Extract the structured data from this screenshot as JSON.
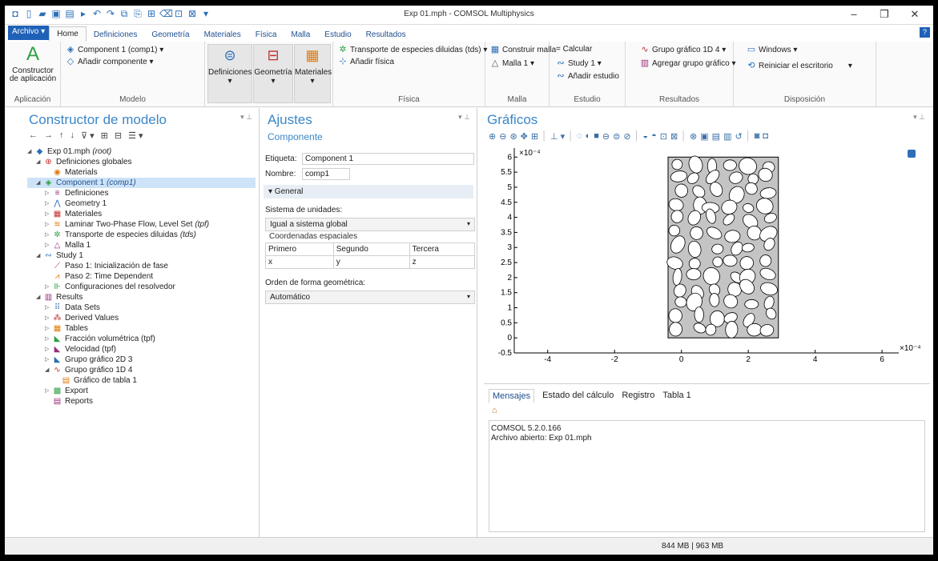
{
  "window": {
    "title": "Exp 01.mph - COMSOL Multiphysics",
    "minimize": "–",
    "restore": "❐",
    "close": "✕"
  },
  "tabs": {
    "file": "Archivo ▾",
    "items": [
      "Home",
      "Definiciones",
      "Geometría",
      "Materiales",
      "Física",
      "Malla",
      "Estudio",
      "Resultados"
    ],
    "help": "?"
  },
  "ribbon": {
    "aplicacion": {
      "btn": "Constructor de aplicación",
      "label": "Aplicación"
    },
    "modelo": {
      "component": "Component 1 (comp1) ▾",
      "add": "Añadir componente ▾",
      "label": "Modelo"
    },
    "defs": {
      "definiciones": "Definiciones",
      "geometria": "Geometría",
      "materiales": "Materiales",
      "arrow": "▾"
    },
    "fisica": {
      "transporte": "Transporte de especies diluidas (tds) ▾",
      "add": "Añadir física",
      "label": "Física"
    },
    "malla": {
      "construir": "Construir malla",
      "malla1": "Malla 1 ▾",
      "label": "Malla"
    },
    "estudio": {
      "calcular": "= Calcular",
      "study": "Study 1 ▾",
      "add": "Añadir estudio",
      "label": "Estudio"
    },
    "resultados": {
      "grupo1d": "Grupo gráfico 1D 4 ▾",
      "agregar": "Agregar grupo gráfico ▾",
      "label": "Resultados"
    },
    "disposicion": {
      "windows": "Windows ▾",
      "reiniciar": "Reiniciar el escritorio",
      "arrow": "▾",
      "label": "Disposición"
    }
  },
  "builder": {
    "title": "Constructor de modelo",
    "tools": [
      "←",
      "→",
      "↑",
      "↓",
      "⊽ ▾",
      "⊞",
      "⊟",
      "☰ ▾"
    ],
    "pin": "▾ ⊥",
    "tree": [
      {
        "label": "Exp 01.mph",
        "tag": "(root)",
        "indent": 0,
        "arrow": "◢",
        "icon": "◆"
      },
      {
        "label": "Definiciones globales",
        "tag": "",
        "indent": 1,
        "arrow": "◢",
        "icon": "⊕"
      },
      {
        "label": "Materials",
        "tag": "",
        "indent": 2,
        "arrow": "",
        "icon": "◉"
      },
      {
        "label": "Component 1",
        "tag": "(comp1)",
        "indent": 1,
        "arrow": "◢",
        "icon": "◈",
        "selected": true
      },
      {
        "label": "Definiciones",
        "tag": "",
        "indent": 2,
        "arrow": "▷",
        "icon": "≡"
      },
      {
        "label": "Geometry 1",
        "tag": "",
        "indent": 2,
        "arrow": "▷",
        "icon": "⋀"
      },
      {
        "label": "Materiales",
        "tag": "",
        "indent": 2,
        "arrow": "▷",
        "icon": "▦"
      },
      {
        "label": "Laminar Two-Phase Flow, Level Set",
        "tag": "(tpf)",
        "indent": 2,
        "arrow": "▷",
        "icon": "≋"
      },
      {
        "label": "Transporte de especies diluidas",
        "tag": "(tds)",
        "indent": 2,
        "arrow": "▷",
        "icon": "✲"
      },
      {
        "label": "Malla 1",
        "tag": "",
        "indent": 2,
        "arrow": "▷",
        "icon": "△"
      },
      {
        "label": "Study 1",
        "tag": "",
        "indent": 1,
        "arrow": "◢",
        "icon": "∾"
      },
      {
        "label": "Paso 1: Inicialización de fase",
        "tag": "",
        "indent": 2,
        "arrow": "",
        "icon": "⟋"
      },
      {
        "label": "Paso 2: Time Dependent",
        "tag": "",
        "indent": 2,
        "arrow": "",
        "icon": "⩘"
      },
      {
        "label": "Configuraciones del resolvedor",
        "tag": "",
        "indent": 2,
        "arrow": "▷",
        "icon": "⊪"
      },
      {
        "label": "Results",
        "tag": "",
        "indent": 1,
        "arrow": "◢",
        "icon": "▥"
      },
      {
        "label": "Data Sets",
        "tag": "",
        "indent": 2,
        "arrow": "▷",
        "icon": "⠿"
      },
      {
        "label": "Derived Values",
        "tag": "",
        "indent": 2,
        "arrow": "▷",
        "icon": "⁂"
      },
      {
        "label": "Tables",
        "tag": "",
        "indent": 2,
        "arrow": "▷",
        "icon": "▦"
      },
      {
        "label": "Fracción volumétrica (tpf)",
        "tag": "",
        "indent": 2,
        "arrow": "▷",
        "icon": "◣"
      },
      {
        "label": "Velocidad (tpf)",
        "tag": "",
        "indent": 2,
        "arrow": "▷",
        "icon": "◣"
      },
      {
        "label": "Grupo gráfico 2D 3",
        "tag": "",
        "indent": 2,
        "arrow": "▷",
        "icon": "◣"
      },
      {
        "label": "Grupo gráfico 1D 4",
        "tag": "",
        "indent": 2,
        "arrow": "◢",
        "icon": "∿"
      },
      {
        "label": "Gráfico de tabla 1",
        "tag": "",
        "indent": 3,
        "arrow": "",
        "icon": "▤"
      },
      {
        "label": "Export",
        "tag": "",
        "indent": 2,
        "arrow": "▷",
        "icon": "▩"
      },
      {
        "label": "Reports",
        "tag": "",
        "indent": 2,
        "arrow": "",
        "icon": "▤"
      }
    ]
  },
  "settings": {
    "title": "Ajustes",
    "subtitle": "Componente",
    "pin": "▾ ⊥",
    "etiqueta_label": "Etiqueta:",
    "etiqueta_value": "Component 1",
    "nombre_label": "Nombre:",
    "nombre_value": "comp1",
    "section": "▾  General",
    "sistema_label": "Sistema de unidades:",
    "sistema_value": "Igual a sistema global",
    "coords_label": "Coordenadas espaciales",
    "coords_headers": [
      "Primero",
      "Segundo",
      "Tercera"
    ],
    "coords_values": [
      "x",
      "y",
      "z"
    ],
    "orden_label": "Orden de forma geométrica:",
    "orden_value": "Automático",
    "dd": "▾"
  },
  "graphics": {
    "title": "Gráficos",
    "pin": "▾ ⊥",
    "tools": [
      "⊕",
      "⊖",
      "⊛",
      "✥",
      "⊞",
      "│",
      "⊥ ▾",
      "│",
      "◌",
      "◐",
      "■",
      "⊖",
      "⊜",
      "⊘",
      "│",
      "◒",
      "◓",
      "⊡",
      "⊠",
      "│",
      "⊗",
      "▣",
      "▤",
      "▥",
      "↺",
      "│",
      "◙",
      "◘"
    ],
    "colors": {
      "fill": "#c4c4c4",
      "holes": "#ffffff",
      "edge": "#000000"
    }
  },
  "chart_data": {
    "type": "scatter",
    "x_exponent": "×10⁻⁴",
    "y_exponent": "×10⁻⁴",
    "xticks": [
      "-4",
      "-2",
      "0",
      "2",
      "4",
      "6"
    ],
    "yticks": [
      "-0.5",
      "0",
      "0.5",
      "1",
      "1.5",
      "2",
      "2.5",
      "3",
      "3.5",
      "4",
      "4.5",
      "5",
      "5.5",
      "6"
    ],
    "xlim": [
      -5,
      6.5
    ],
    "ylim": [
      -0.5,
      6.3
    ],
    "domain": {
      "xmin": -0.4,
      "xmax": 2.9,
      "ymin": 0,
      "ymax": 6.0
    }
  },
  "messages": {
    "tabs": [
      "Mensajes",
      "Estado del cálculo",
      "Registro",
      "Tabla 1"
    ],
    "lines": [
      "COMSOL 5.2.0.166",
      "Archivo abierto: Exp 01.mph"
    ]
  },
  "status": {
    "memory": "844 MB | 963 MB"
  }
}
